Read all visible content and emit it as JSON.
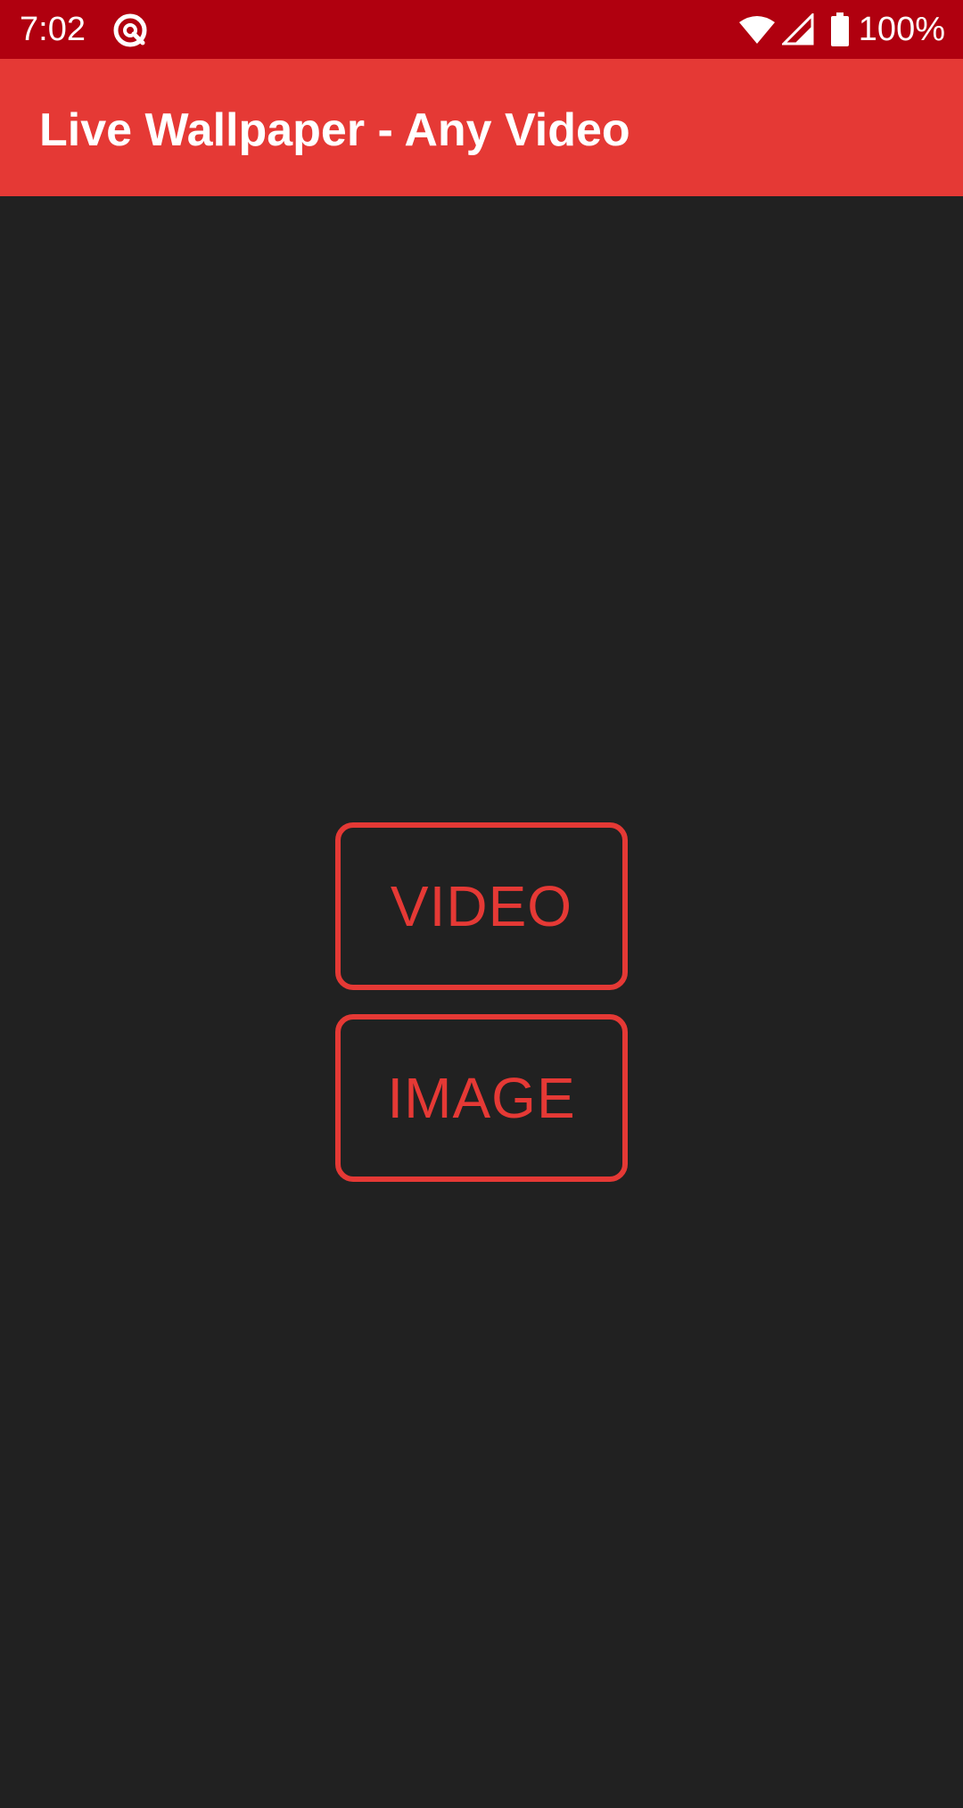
{
  "status_bar": {
    "time": "7:02",
    "battery": "100%",
    "icons": [
      "app-notification-icon",
      "wifi-icon",
      "signal-icon",
      "battery-icon"
    ]
  },
  "app_bar": {
    "title": "Live Wallpaper - Any Video"
  },
  "main": {
    "video_button_label": "VIDEO",
    "image_button_label": "IMAGE"
  },
  "colors": {
    "status_bar": "#b0000f",
    "app_bar": "#e53935",
    "background": "#212121",
    "accent": "#e53935"
  }
}
